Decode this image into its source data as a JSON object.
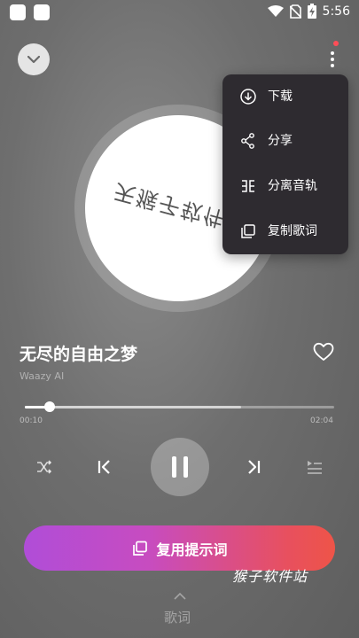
{
  "status_bar": {
    "time": "5:56",
    "icons": [
      "app-square-icon",
      "app-square-icon",
      "wifi-icon",
      "no-sim-icon",
      "battery-charging-icon"
    ]
  },
  "header": {
    "collapse_icon": "chevron-down-icon",
    "more_icon": "more-vertical-icon",
    "has_notification_dot": true
  },
  "disc": {
    "art_text": "天猴子软件站"
  },
  "menu": {
    "items": [
      {
        "label": "下载",
        "icon": "download-icon"
      },
      {
        "label": "分享",
        "icon": "share-icon"
      },
      {
        "label": "分离音轨",
        "icon": "split-track-icon"
      },
      {
        "label": "复制歌词",
        "icon": "copy-icon"
      }
    ]
  },
  "track": {
    "title": "无尽的自由之梦",
    "artist": "Waazy AI",
    "liked": false
  },
  "progress": {
    "current": "00:10",
    "total": "02:04",
    "played_fraction": 0.08,
    "buffered_fraction": 0.7
  },
  "controls": {
    "shuffle_icon": "shuffle-icon",
    "prev_icon": "skip-previous-icon",
    "play_state": "playing",
    "pause_icon": "pause-icon",
    "next_icon": "skip-next-icon",
    "queue_icon": "queue-icon"
  },
  "cta": {
    "label": "复用提示词",
    "icon": "copy-icon"
  },
  "watermark": "猴子软件站",
  "lyrics": {
    "label": "歌词",
    "icon": "chevron-up-icon"
  },
  "colors": {
    "accent_start": "#b04dd8",
    "accent_end": "#ee5448",
    "menu_bg": "#2e2b30",
    "notification_dot": "#ff4d57"
  }
}
